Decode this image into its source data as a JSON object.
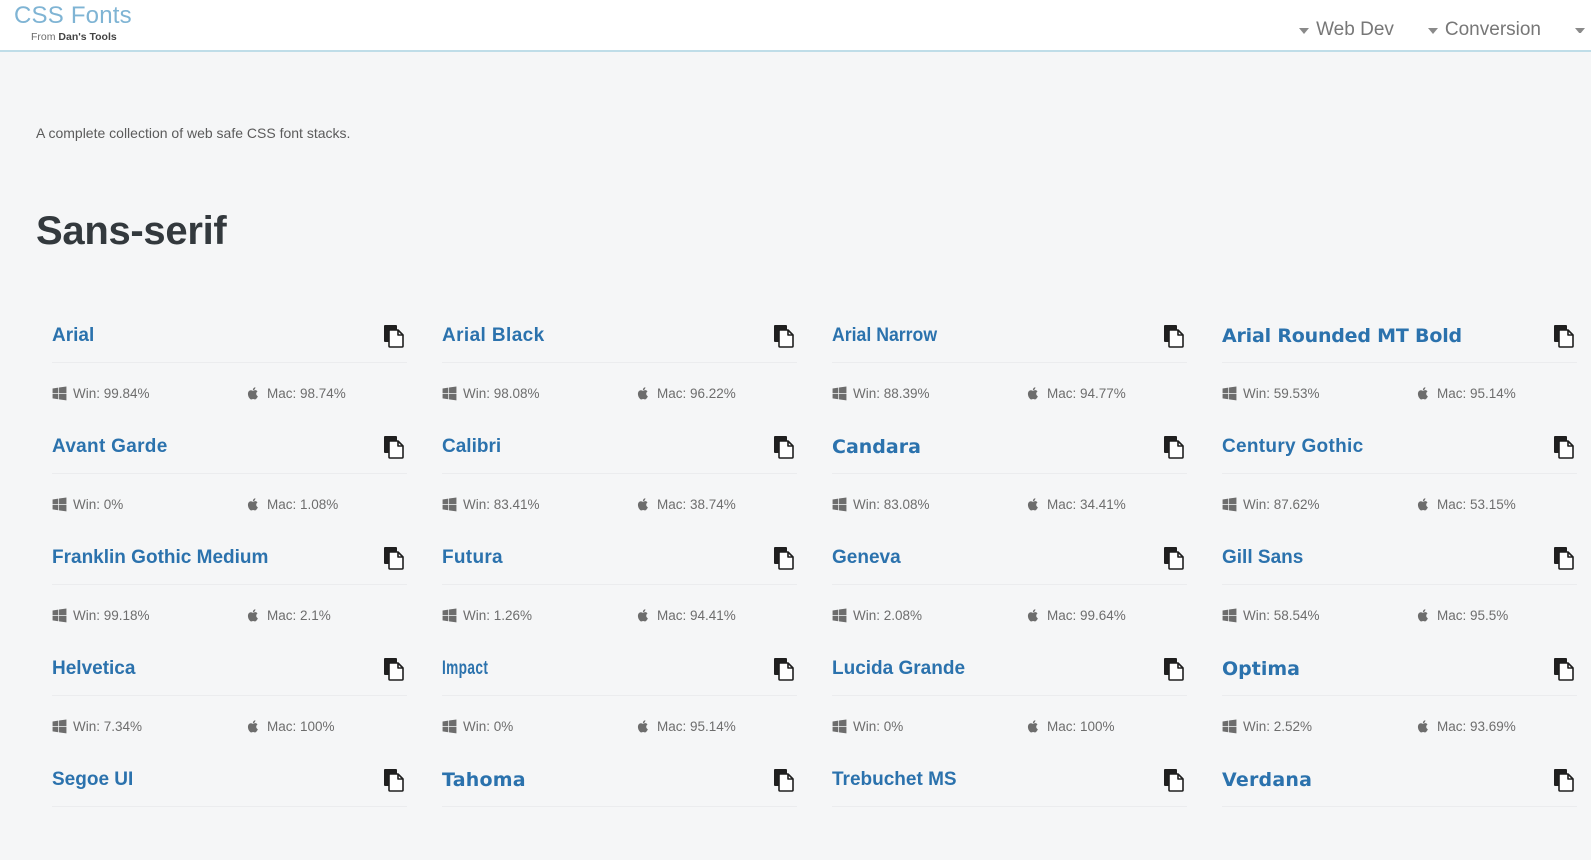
{
  "header": {
    "brand_title": "CSS Fonts",
    "brand_sub_prefix": "From ",
    "brand_sub_strong": "Dan's Tools",
    "nav": [
      {
        "label": "Web Dev",
        "icon": "chevron-down-icon"
      },
      {
        "label": "Conversion",
        "icon": "chevron-down-icon"
      },
      {
        "label": "",
        "icon": "chevron-down-icon"
      }
    ]
  },
  "main": {
    "intro": "A complete collection of web safe CSS font stacks.",
    "section_title": "Sans-serif",
    "win_label": "Win:",
    "mac_label": "Mac:",
    "copy_icon": "copy-icon",
    "win_icon": "windows-logo-icon",
    "mac_icon": "apple-logo-icon",
    "fonts": [
      {
        "name": "Arial",
        "win": "Win: 99.84%",
        "mac": "Mac: 98.74%",
        "face": "f-default"
      },
      {
        "name": "Arial Black",
        "win": "Win: 98.08%",
        "mac": "Mac: 96.22%",
        "face": "f-black"
      },
      {
        "name": "Arial Narrow",
        "win": "Win: 88.39%",
        "mac": "Mac: 94.77%",
        "face": "f-narrow"
      },
      {
        "name": "Arial Rounded MT Bold",
        "win": "Win: 59.53%",
        "mac": "Mac: 95.14%",
        "face": "f-rounded"
      },
      {
        "name": "Avant Garde",
        "win": "Win: 0%",
        "mac": "Mac: 1.08%",
        "face": "f-geo"
      },
      {
        "name": "Calibri",
        "win": "Win: 83.41%",
        "mac": "Mac: 38.74%",
        "face": "f-default"
      },
      {
        "name": "Candara",
        "win": "Win: 83.08%",
        "mac": "Mac: 34.41%",
        "face": "f-serifish"
      },
      {
        "name": "Century Gothic",
        "win": "Win: 87.62%",
        "mac": "Mac: 53.15%",
        "face": "f-geo"
      },
      {
        "name": "Franklin Gothic Medium",
        "win": "Win: 99.18%",
        "mac": "Mac: 2.1%",
        "face": "f-default"
      },
      {
        "name": "Futura",
        "win": "Win: 1.26%",
        "mac": "Mac: 94.41%",
        "face": "f-geo"
      },
      {
        "name": "Geneva",
        "win": "Win: 2.08%",
        "mac": "Mac: 99.64%",
        "face": "f-default"
      },
      {
        "name": "Gill Sans",
        "win": "Win: 58.54%",
        "mac": "Mac: 95.5%",
        "face": "f-default"
      },
      {
        "name": "Helvetica",
        "win": "Win: 7.34%",
        "mac": "Mac: 100%",
        "face": "f-default"
      },
      {
        "name": "Impact",
        "win": "Win: 0%",
        "mac": "Mac: 95.14%",
        "face": "f-impact"
      },
      {
        "name": "Lucida Grande",
        "win": "Win: 0%",
        "mac": "Mac: 100%",
        "face": "f-default"
      },
      {
        "name": "Optima",
        "win": "Win: 2.52%",
        "mac": "Mac: 93.69%",
        "face": "f-serifish"
      },
      {
        "name": "Segoe UI",
        "win": "",
        "mac": "",
        "face": "f-default"
      },
      {
        "name": "Tahoma",
        "win": "",
        "mac": "",
        "face": "f-wide"
      },
      {
        "name": "Trebuchet MS",
        "win": "",
        "mac": "",
        "face": "f-default"
      },
      {
        "name": "Verdana",
        "win": "",
        "mac": "",
        "face": "f-wide"
      }
    ]
  },
  "colors": {
    "brand": "#7fb4d4",
    "link": "#2b72ad",
    "header_border": "#bfdde8",
    "page_bg": "#f5f6f7",
    "text": "#5b5b5b",
    "heading": "#33393d"
  }
}
